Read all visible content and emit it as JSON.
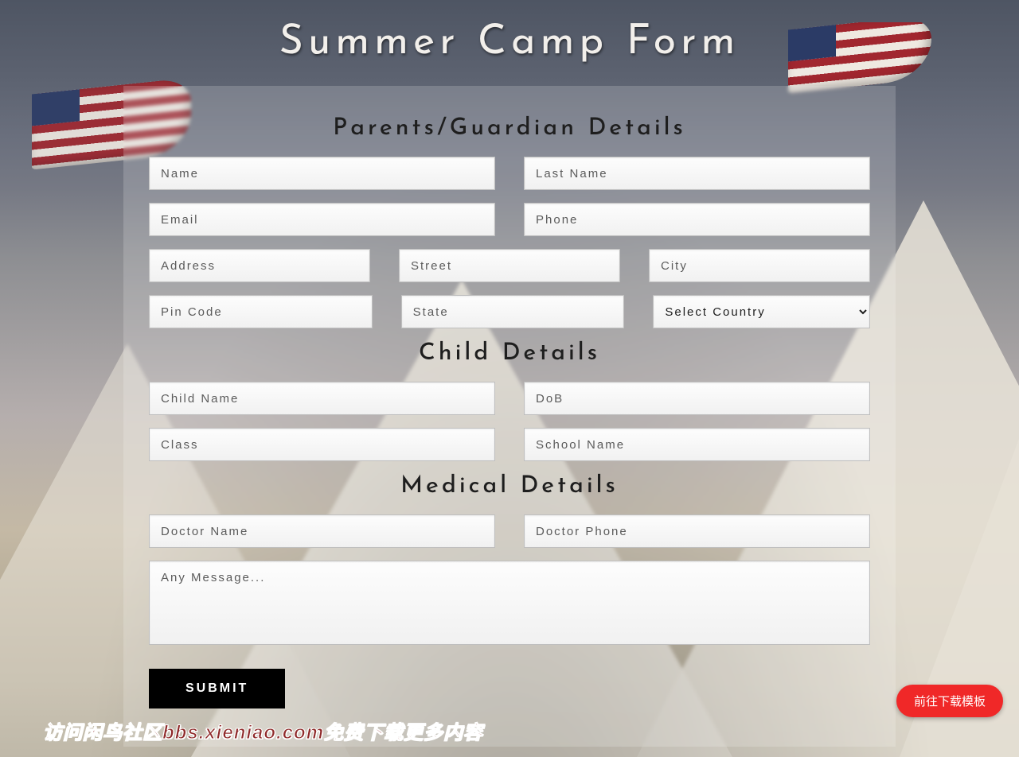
{
  "title": "Summer Camp Form",
  "sections": {
    "parents": {
      "heading": "Parents/Guardian Details",
      "name_ph": "Name",
      "lastname_ph": "Last Name",
      "email_ph": "Email",
      "phone_ph": "Phone",
      "address_ph": "Address",
      "street_ph": "Street",
      "city_ph": "City",
      "pin_ph": "Pin Code",
      "state_ph": "State",
      "country_default": "Select Country"
    },
    "child": {
      "heading": "Child Details",
      "name_ph": "Child Name",
      "dob_ph": "DoB",
      "class_ph": "Class",
      "school_ph": "School Name"
    },
    "medical": {
      "heading": "Medical Details",
      "doctor_name_ph": "Doctor Name",
      "doctor_phone_ph": "Doctor Phone",
      "message_ph": "Any Message..."
    }
  },
  "submit_label": "SUBMIT",
  "watermark_text": "访问闲鸟社区bbs.xieniao.com免费下载更多内容",
  "pill_label": "前往下载模板"
}
